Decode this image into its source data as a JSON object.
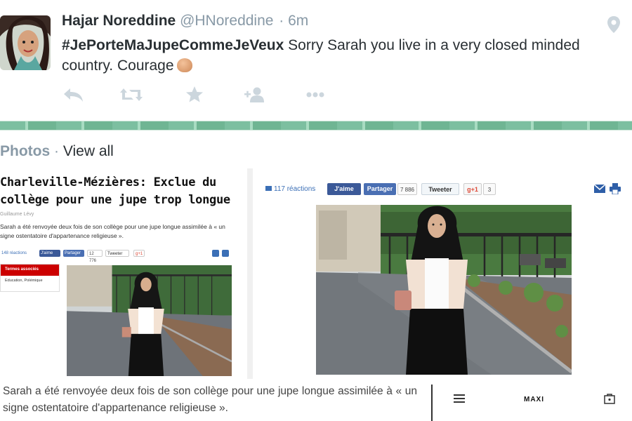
{
  "tweet": {
    "name": "Hajar Noreddine",
    "handle": "@HNoreddine",
    "time": "· 6m",
    "hashtag": "#JePorteMaJupeCommeJeVeux",
    "text": " Sorry Sarah you live in a very closed minded country. Courage",
    "actions": [
      "reply-icon",
      "retweet-icon",
      "favorite-icon",
      "follow-icon",
      "more-icon"
    ]
  },
  "photos": {
    "title": "Photos",
    "separator": " · ",
    "view_all": "View all"
  },
  "left_article": {
    "title": "Charleville-Mézières: Exclue du collège pour une jupe trop longue",
    "author": "Guillaume Lévy",
    "lead": "Sarah a été renvoyée deux fois de son collège pour une jupe longue assimilée à « un signe ostentatoire d'appartenance religieuse ».",
    "reactions": "148 réactions",
    "like": "J'aime",
    "share": "Partager",
    "count": "12 776",
    "tweet": "Tweeter",
    "gplus": "g+1",
    "tags_title": "Termes associés",
    "tags": "Education, Polémique"
  },
  "right_article": {
    "reactions": "117 réactions",
    "like": "J'aime",
    "share": "Partager",
    "count": "7 886",
    "tweet": "Tweeter",
    "gplus": "g+1",
    "gplus_count": "3"
  },
  "caption": "Sarah a été renvoyée deux fois de son collège pour une jupe longue assimilée à « un signe ostentatoire d'appartenance religieuse ».",
  "shop": {
    "brand": "MAXI"
  },
  "colors": {
    "twitter_gray": "#8899a6",
    "text": "#292f33",
    "facebook": "#3b5998",
    "green_strip": "#7cbfa0",
    "red_tag": "#cc0000"
  }
}
